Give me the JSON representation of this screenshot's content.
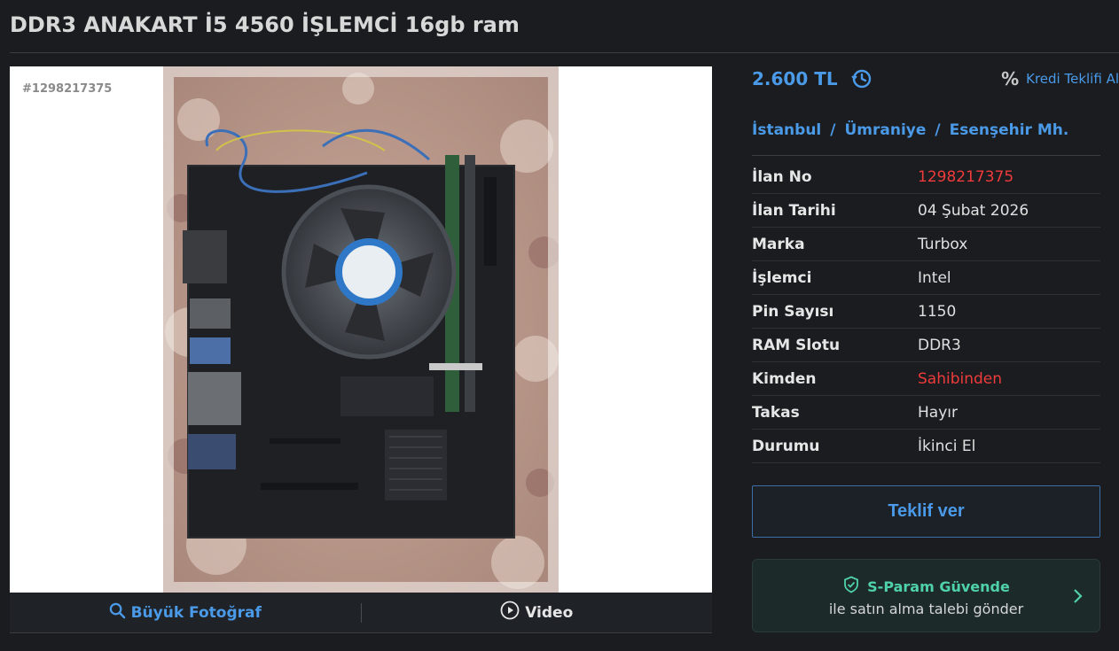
{
  "listing": {
    "title": "DDR3 ANAKART İ5 4560 İŞLEMCİ 16gb ram",
    "photo_id": "#1298217375"
  },
  "photo_bar": {
    "big_photo_label": "Büyük Fotoğraf",
    "video_label": "Video"
  },
  "price": {
    "amount": "2.600 TL",
    "credit_label": "Kredi Teklifi Al"
  },
  "location": {
    "city": "İstanbul",
    "district": "Ümraniye",
    "neighborhood": "Esenşehir Mh.",
    "separator": "/"
  },
  "info": [
    {
      "label": "İlan No",
      "value": "1298217375",
      "highlight": true
    },
    {
      "label": "İlan Tarihi",
      "value": "04 Şubat 2026",
      "highlight": false
    },
    {
      "label": "Marka",
      "value": "Turbox",
      "highlight": false
    },
    {
      "label": "İşlemci",
      "value": "Intel",
      "highlight": false
    },
    {
      "label": "Pin Sayısı",
      "value": "1150",
      "highlight": false
    },
    {
      "label": "RAM Slotu",
      "value": "DDR3",
      "highlight": false
    },
    {
      "label": "Kimden",
      "value": "Sahibinden",
      "highlight": true
    },
    {
      "label": "Takas",
      "value": "Hayır",
      "highlight": false
    },
    {
      "label": "Durumu",
      "value": "İkinci El",
      "highlight": false
    }
  ],
  "actions": {
    "offer_label": "Teklif ver",
    "sparam_title": "S-Param Güvende",
    "sparam_sub": "ile satın alma talebi gönder"
  },
  "colors": {
    "accent": "#4a9ae8",
    "highlight": "#ef3b3b",
    "secure": "#4fd1a9",
    "background": "#1a1c1f"
  },
  "icons": {
    "history": "history-clock-icon",
    "percent": "percent-icon",
    "search": "search-icon",
    "play": "play-icon",
    "shield": "shield-check-icon",
    "chevron": "chevron-right-icon"
  }
}
